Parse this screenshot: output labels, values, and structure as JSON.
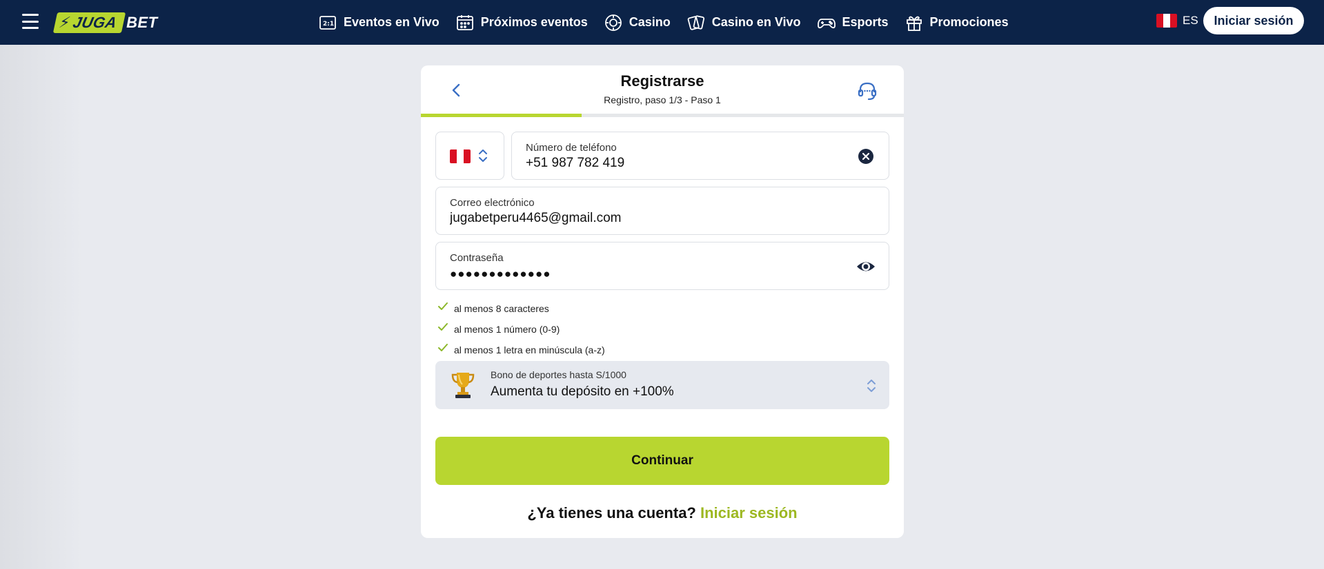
{
  "header": {
    "logo_part1": "JUGA",
    "logo_part2": "BET",
    "nav": [
      {
        "label": "Eventos en Vivo",
        "icon": "live-events-icon"
      },
      {
        "label": "Próximos eventos",
        "icon": "calendar-icon"
      },
      {
        "label": "Casino",
        "icon": "casino-chip-icon"
      },
      {
        "label": "Casino en Vivo",
        "icon": "cards-icon"
      },
      {
        "label": "Esports",
        "icon": "gamepad-icon"
      },
      {
        "label": "Promociones",
        "icon": "gift-icon"
      }
    ],
    "lang": "ES",
    "login_label": "Iniciar sesión"
  },
  "form": {
    "title": "Registrarse",
    "subtitle": "Registro, paso 1/3 - Paso 1",
    "progress": 0.333,
    "phone": {
      "label": "Número de teléfono",
      "value": "+51 987 782 419"
    },
    "email": {
      "label": "Correo electrónico",
      "value": "jugabetperu4465@gmail.com"
    },
    "password": {
      "label": "Contraseña",
      "value": "●●●●●●●●●●●●●"
    },
    "rules": [
      "al menos 8 caracteres",
      "al menos 1 número (0-9)",
      "al menos 1 letra en minúscula (a-z)"
    ],
    "bonus": {
      "label": "Bono de deportes hasta S/1000",
      "value": "Aumenta tu depósito en +100%"
    },
    "continue_label": "Continuar",
    "have_account": "¿Ya tienes una cuenta?",
    "login_link": "Iniciar sesión"
  },
  "colors": {
    "header_bg": "#0c2348",
    "accent": "#b8d630",
    "link": "#9db822",
    "page_bg": "#e8eaef"
  }
}
